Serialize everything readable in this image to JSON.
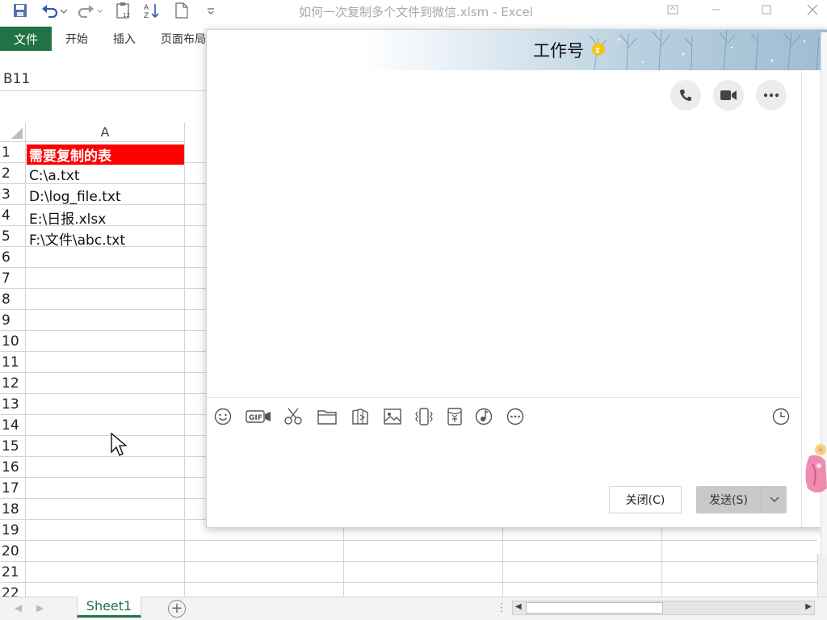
{
  "window": {
    "title": "如何一次复制多个文件到微信.xlsm - Excel"
  },
  "ribbon": {
    "file_tab": "文件",
    "tabs": [
      "开始",
      "插入",
      "页面布局"
    ]
  },
  "formula_bar": {
    "name_box": "B11"
  },
  "grid": {
    "column_headers": [
      "A"
    ],
    "row_numbers": [
      "1",
      "2",
      "3",
      "4",
      "5",
      "6",
      "7",
      "8",
      "9",
      "10",
      "11",
      "12",
      "13",
      "14",
      "15",
      "16",
      "17",
      "18",
      "19",
      "20",
      "21",
      "22"
    ],
    "column_a": [
      "需要复制的表",
      "C:\\a.txt",
      "D:\\log_file.txt",
      "E:\\日报.xlsx",
      "F:\\文件\\abc.txt"
    ]
  },
  "sheets": {
    "tabs": [
      "Sheet1"
    ],
    "active": "Sheet1"
  },
  "chat": {
    "contact_name": "工作号",
    "close_button": "关闭(C)",
    "send_button": "发送(S)",
    "header_icons": [
      "phone-icon",
      "video-call-icon",
      "more-icon"
    ],
    "toolbar_icons": [
      "emoji-icon",
      "gif-icon",
      "screenshot-icon",
      "folder-icon",
      "file-send-icon",
      "image-icon",
      "shake-icon",
      "red-packet-icon",
      "music-icon",
      "more-options-icon",
      "history-icon"
    ]
  },
  "colors": {
    "excel_green": "#217346",
    "header_red": "#ff0000",
    "send_button_gray": "#c9c9c9"
  }
}
